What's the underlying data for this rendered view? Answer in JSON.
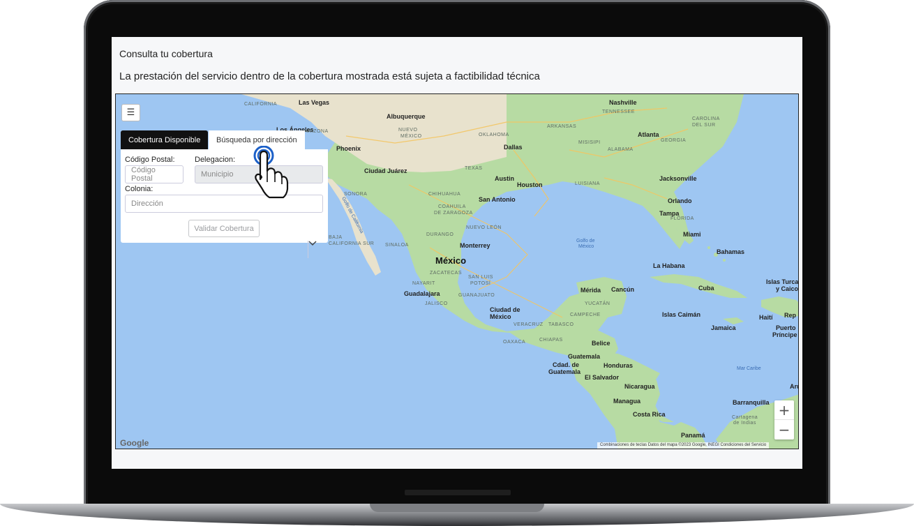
{
  "page": {
    "title": "Consulta tu cobertura",
    "subtitle": "La prestación del servicio dentro de la cobertura mostrada está sujeta a factibilidad técnica"
  },
  "panel": {
    "tabs": [
      {
        "label": "Cobertura Disponible",
        "active": true
      },
      {
        "label": "Búsqueda por dirección",
        "active": false
      }
    ],
    "postal_label": "Código Postal:",
    "postal_placeholder": "Código Postal",
    "delegacion_label": "Delegacion:",
    "delegacion_placeholder": "Municipio",
    "colonia_label": "Colonia:",
    "colonia_value": "Dirección",
    "validate_label": "Validar Cobertura"
  },
  "map": {
    "zoom_in": "+",
    "zoom_out": "−",
    "google_logo": "Google",
    "attribution": "Combinaciones de teclas   Datos del mapa ©2023 Google, INEGI   Condiciones del Servicio",
    "labels": {
      "mexico": "México",
      "las_vegas": "Las Vegas",
      "albuquerque": "Albuquerque",
      "nuevo_mexico": "NUEVO\nMÉXICO",
      "los_angeles": "Los Ángeles",
      "phoenix": "Phoenix",
      "ciudad_juarez": "Ciudad Juárez",
      "dallas": "Dallas",
      "austin": "Austin",
      "houston": "Houston",
      "san_antonio": "San Antonio",
      "monterrey": "Monterrey",
      "guadalajara": "Guadalajara",
      "ciudad_de_mexico": "Ciudad de\nMéxico",
      "nashville": "Nashville",
      "atlanta": "Atlanta",
      "jacksonville": "Jacksonville",
      "orlando": "Orlando",
      "tampa": "Tampa",
      "miami": "Miami",
      "bahamas": "Bahamas",
      "la_habana": "La Habana",
      "cuba": "Cuba",
      "islas_caiman": "Islas Caimán",
      "jamaica": "Jamaica",
      "haiti": "Haití",
      "puerto_principe": "Puerto\nPríncipe",
      "islas_turcas": "Islas Turcas\ny Caicos",
      "rep": "Rep",
      "merida": "Mérida",
      "cancun": "Cancún",
      "belice": "Belice",
      "guatemala": "Guatemala",
      "cdad_guatemala": "Cdad. de\nGuatemala",
      "honduras": "Honduras",
      "el_salvador": "El Salvador",
      "nicaragua": "Nicaragua",
      "managua": "Managua",
      "costa_rica": "Costa Rica",
      "panama": "Panamá",
      "barranquilla": "Barranquilla",
      "cartagena": "Cartagena\nde Indias",
      "aru": "Aru",
      "golfo_de_mexico": "Golfo de\nMéxico",
      "mar_caribe": "Mar Caribe",
      "golfo_california": "Golfo de California",
      "california": "CALIFORNIA",
      "arizona": "ARIZONA",
      "texas": "TEXAS",
      "oklahoma": "OKLAHOMA",
      "arkansas": "ARKANSAS",
      "misisipi": "MISISIPI",
      "alabama": "ALABAMA",
      "georgia": "GEORGIA",
      "luisiana": "LUISIANA",
      "florida": "FLORIDA",
      "carolina_del_sur": "CAROLINA\nDEL SUR",
      "tennessee": "TENNESSEE",
      "coahuila": "COAHUILA\nDE ZARAGOZA",
      "nuevo_leon": "NUEVO LEÓN",
      "sinaloa": "SINALOA",
      "durango": "DURANGO",
      "zacatecas": "ZACATECAS",
      "nayarit": "NAYARIT",
      "jalisco": "JALISCO",
      "guanajuato": "GUANAJUATO",
      "san_luis_potosi": "SAN LUIS\nPOTOSÍ",
      "veracruz": "VERACRUZ",
      "oaxaca": "OAXACA",
      "chiapas": "CHIAPAS",
      "tabasco": "TABASCO",
      "campeche": "CAMPECHE",
      "yucatan": "YUCATÁN",
      "baja_california_sur": "BAJA\nCALIFORNIA SUR",
      "sonora": "SONORA",
      "chihuahua": "CHIHUAHUA"
    }
  }
}
